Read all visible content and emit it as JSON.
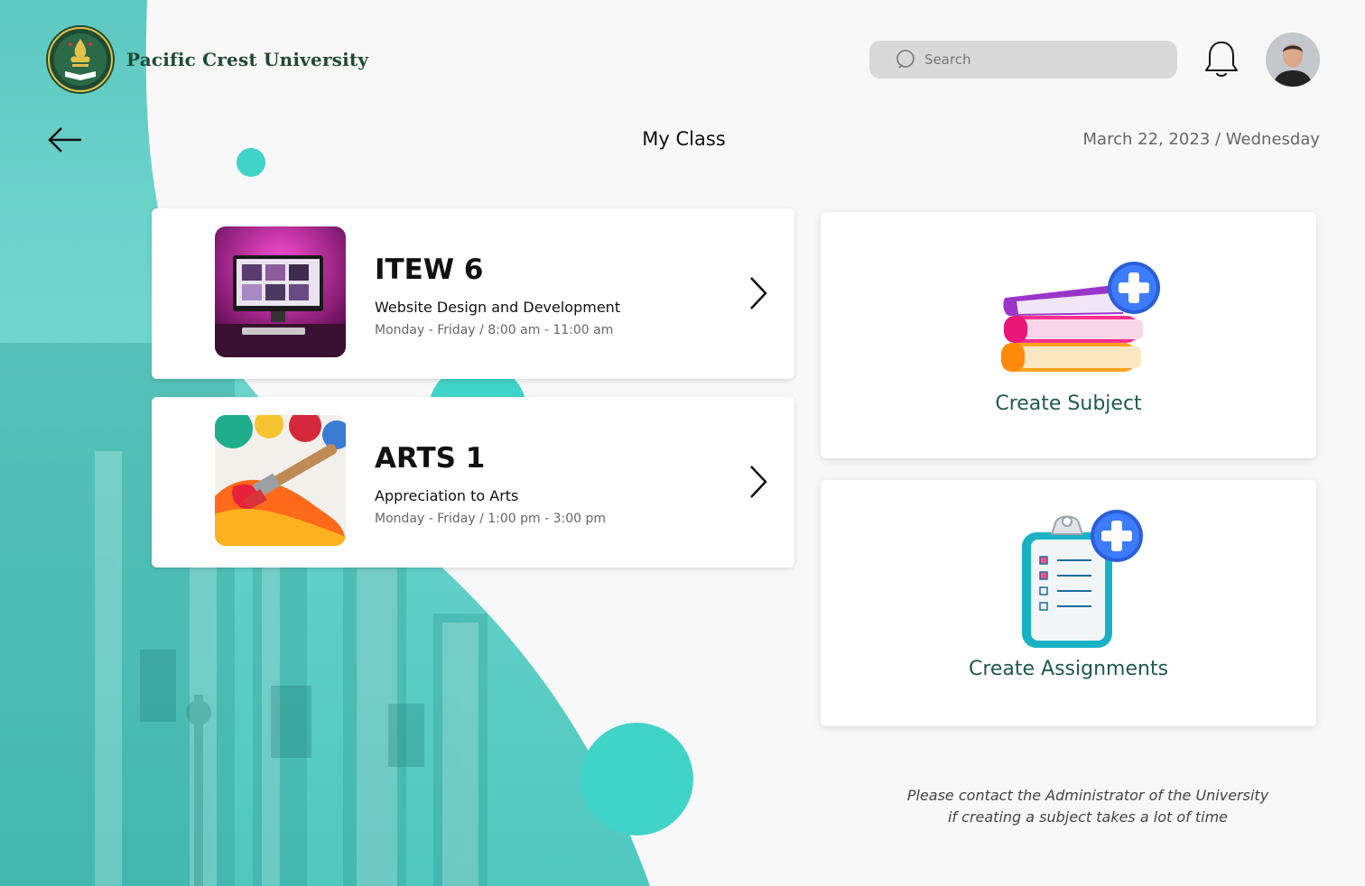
{
  "header": {
    "brand": "Pacific Crest University",
    "search_placeholder": "Search"
  },
  "page": {
    "title": "My Class",
    "date": "March 22, 2023 / Wednesday"
  },
  "classes": [
    {
      "code": "ITEW 6",
      "name": "Website Design and Development",
      "schedule": "Monday - Friday / 8:00 am - 11:00 am"
    },
    {
      "code": "ARTS 1",
      "name": "Appreciation to Arts",
      "schedule": "Monday - Friday / 1:00 pm - 3:00 pm"
    }
  ],
  "actions": {
    "create_subject": "Create Subject",
    "create_assignments": "Create Assignments"
  },
  "note": "Please contact the Administrator of the University if creating a subject takes a lot of time",
  "colors": {
    "accent_teal": "#3fd4c7",
    "label_green": "#1d5a4d",
    "brand_green": "#1f4a32"
  }
}
